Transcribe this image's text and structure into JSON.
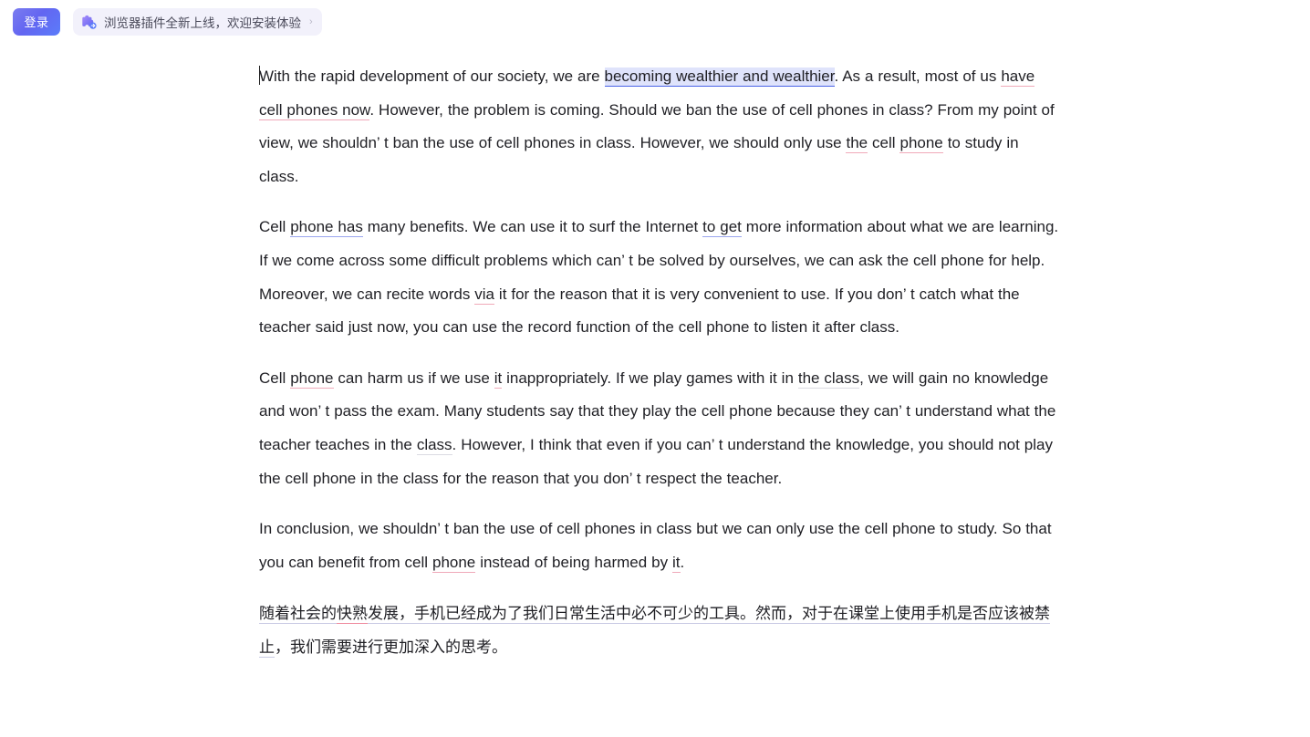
{
  "topbar": {
    "login_label": "登录",
    "promo_text": "浏览器插件全新上线，欢迎安装体验",
    "promo_chevron": "›",
    "promo_icon": "puzzle-plugin-icon",
    "accent_color": "#6366f1",
    "promo_bg": "#f2f1fb"
  },
  "editor": {
    "paragraphs": [
      {
        "id": "p1",
        "segments": [
          {
            "text": "With the rapid development of our society, we are ",
            "mark": "none"
          },
          {
            "text": "becoming wealthier and wealthier",
            "mark": "blue-highlight"
          },
          {
            "text": ". As a result, most of us ",
            "mark": "none"
          },
          {
            "text": "have cell phones now",
            "mark": "pink"
          },
          {
            "text": ". However, the problem is coming. Should we ban the use of cell phones in class? From my point of view, we shouldn’ t ban the use of cell phones in class. However, we should only use ",
            "mark": "none"
          },
          {
            "text": "the",
            "mark": "pink"
          },
          {
            "text": " cell ",
            "mark": "none"
          },
          {
            "text": "phone",
            "mark": "pink"
          },
          {
            "text": " to study in class.",
            "mark": "none"
          }
        ]
      },
      {
        "id": "p2",
        "segments": [
          {
            "text": "Cell ",
            "mark": "none"
          },
          {
            "text": "phone has",
            "mark": "blue"
          },
          {
            "text": " many benefits. We can use it to surf the Internet ",
            "mark": "none"
          },
          {
            "text": "to get",
            "mark": "blue"
          },
          {
            "text": " more information about what we are learning. If we come across some difficult problems which can’ t be solved by ourselves, we can ask the cell phone for help. Moreover, we can recite words ",
            "mark": "none"
          },
          {
            "text": "via",
            "mark": "pink"
          },
          {
            "text": " it for the reason that it is very convenient to use. If you don’ t catch what the teacher said just now, you can use the record function of the cell phone to listen it after class.",
            "mark": "none"
          }
        ]
      },
      {
        "id": "p3",
        "segments": [
          {
            "text": "Cell ",
            "mark": "none"
          },
          {
            "text": "phone",
            "mark": "pink"
          },
          {
            "text": " can harm us if we use ",
            "mark": "none"
          },
          {
            "text": "it",
            "mark": "pink"
          },
          {
            "text": " inappropriately. If we play games with it in ",
            "mark": "none"
          },
          {
            "text": "the class",
            "mark": "faint"
          },
          {
            "text": ", we will gain no knowledge and won’ t pass the exam. Many students say that they play the cell phone because they can’ t understand what the teacher teaches in the ",
            "mark": "none"
          },
          {
            "text": "class",
            "mark": "faint"
          },
          {
            "text": ". However, I think that even if you can’ t understand the knowledge, you should not play the cell phone in the class for the reason that you don’ t respect the teacher.",
            "mark": "none"
          }
        ]
      },
      {
        "id": "p4",
        "segments": [
          {
            "text": "In conclusion, we shouldn’ t ban the use of cell phones in class but we can only use the cell phone to study. So that you can benefit from cell ",
            "mark": "none"
          },
          {
            "text": "phone",
            "mark": "pink"
          },
          {
            "text": " instead of being harmed by ",
            "mark": "none"
          },
          {
            "text": "it",
            "mark": "pink"
          },
          {
            "text": ".",
            "mark": "none"
          }
        ]
      },
      {
        "id": "p5-cn",
        "chinese": true,
        "segments": [
          {
            "text": "随着社会的",
            "mark": "cn"
          },
          {
            "text": "快熟",
            "mark": "red-cn"
          },
          {
            "text": "发展，手机已经成为了我们日常生活中必不可少的工具。然而，对于在课堂上使用手机是否应该被禁止",
            "mark": "cn"
          },
          {
            "text": "，我们需要进行更加深入的思考。",
            "mark": "none"
          }
        ]
      }
    ],
    "colors": {
      "text": "#1f1f24",
      "blue_underline": "#4a63e7",
      "blue_highlight_bg": "#dfe3fb",
      "pink_underline": "#f0a9b9",
      "red_cn_underline": "#ef8ca0"
    }
  }
}
